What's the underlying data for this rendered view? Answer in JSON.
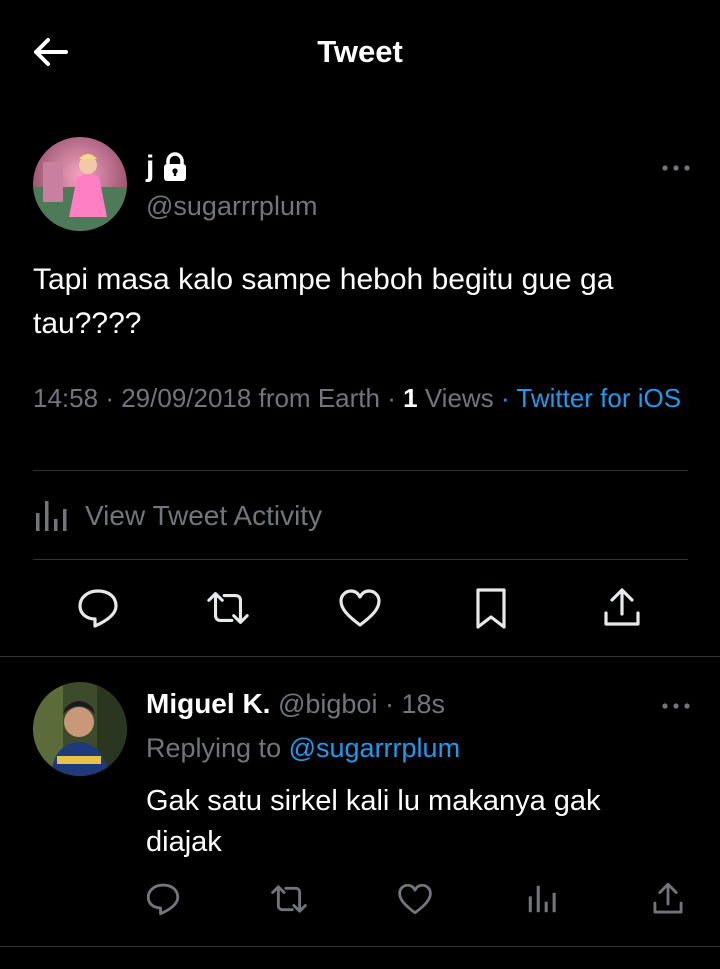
{
  "header": {
    "title": "Tweet",
    "back_icon": "arrow-left-icon"
  },
  "tweet": {
    "author_name": "j",
    "locked": true,
    "author_handle": "@sugarrrplum",
    "text": "Tapi masa kalo sampe heboh begitu gue ga tau????",
    "time": "14:58",
    "date": "29/09/2018",
    "location": "from Earth",
    "views_count": "1",
    "views_label": "Views",
    "source": "Twitter for iOS",
    "separator": "·",
    "activity_label": "View Tweet Activity"
  },
  "reply": {
    "author_name": "Miguel K.",
    "author_handle": "@bigboi",
    "separator": "·",
    "age": "18s",
    "replying_label": "Replying to",
    "replying_handle": "@sugarrrplum",
    "text": "Gak satu sirkel kali lu makanya gak diajak"
  },
  "colors": {
    "background": "#000000",
    "text": "#ffffff",
    "secondary": "#71767b",
    "accent": "#1d9bf0",
    "divider": "#2f3336"
  }
}
